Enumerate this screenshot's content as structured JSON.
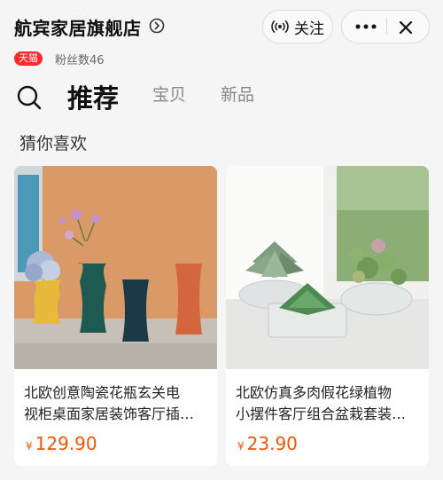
{
  "header": {
    "store_name": "航宾家居旗舰店",
    "follow_label": "关注",
    "badge": "天猫",
    "fans": "粉丝数46"
  },
  "tabs": [
    {
      "label": "推荐"
    },
    {
      "label": "宝贝"
    },
    {
      "label": "新品"
    }
  ],
  "section_title": "猜你喜欢",
  "products": [
    {
      "title_line1": "北欧创意陶瓷花瓶玄关电",
      "title_line2": "视柜桌面家居装饰客厅插…",
      "currency": "¥",
      "price": "129.90"
    },
    {
      "title_line1": "北欧仿真多肉假花绿植物",
      "title_line2": "小摆件客厅组合盆栽套装…",
      "currency": "¥",
      "price": "23.90"
    }
  ],
  "colors": {
    "price": "#f0550a",
    "badge": "#ff2a2a",
    "background": "#f5f5f5"
  },
  "icons": [
    "chevron-right-circle-icon",
    "broadcast-icon",
    "more-icon",
    "close-icon",
    "search-icon"
  ]
}
